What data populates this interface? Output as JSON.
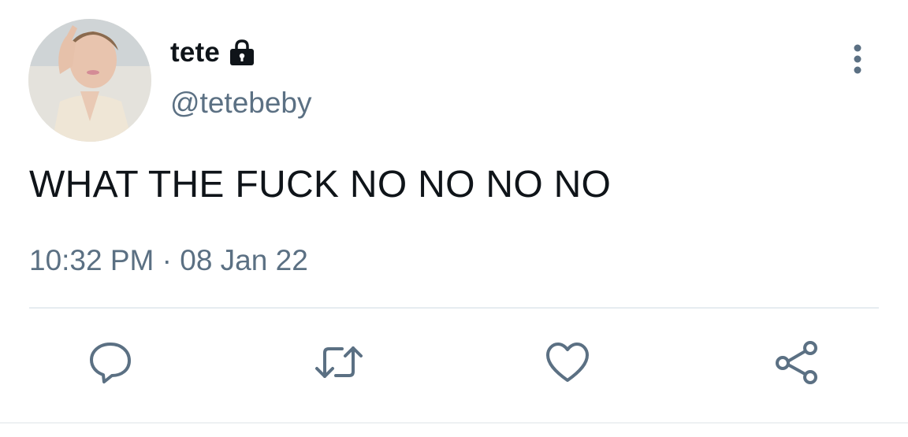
{
  "tweet": {
    "display_name": "tete",
    "handle": "@tetebeby",
    "text": "WHAT THE FUCK NO NO NO NO",
    "timestamp": "10:32 PM · 08 Jan 22",
    "protected": true
  },
  "icons": {
    "lock": "lock-icon",
    "more": "more-vertical-icon",
    "reply": "reply-icon",
    "retweet": "retweet-icon",
    "like": "heart-icon",
    "share": "share-icon"
  },
  "colors": {
    "text_primary": "#0f1419",
    "text_secondary": "#5b7083",
    "divider": "#e6ecf0",
    "background": "#ffffff"
  }
}
